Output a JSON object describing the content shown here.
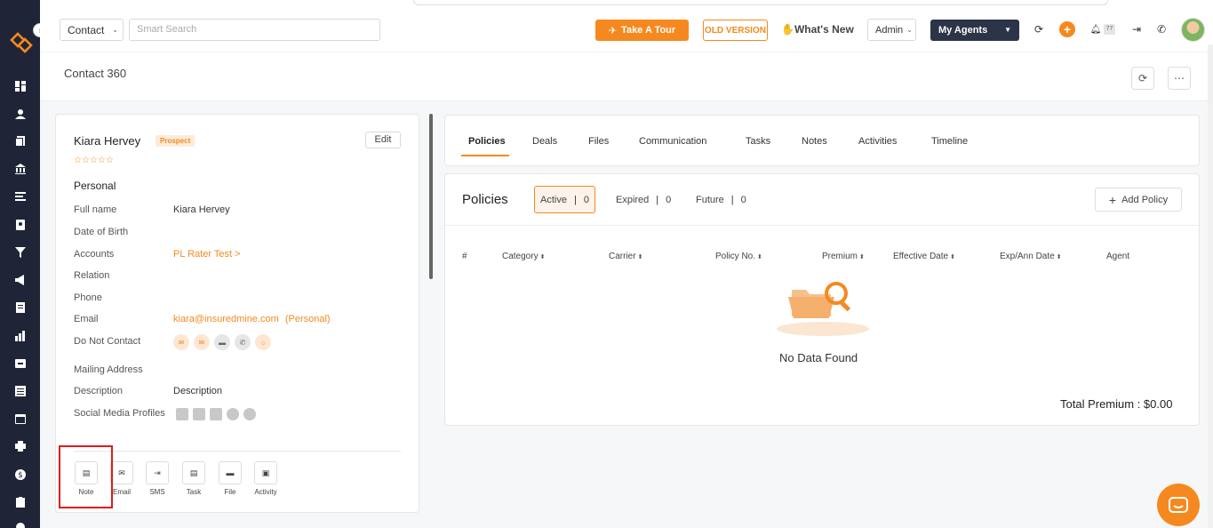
{
  "topbar": {
    "entity_select": "Contact",
    "search_placeholder": "Smart Search",
    "tour_label": "Take A Tour",
    "old_version_label": "OLD VERSION",
    "whats_new_label": "What's New",
    "role_select": "Admin",
    "agents_label": "My Agents",
    "notification_count": "77"
  },
  "page": {
    "title": "Contact 360"
  },
  "contact": {
    "name": "Kiara Hervey",
    "status": "Prospect",
    "rating": "☆☆☆☆☆",
    "edit_label": "Edit",
    "section": "Personal",
    "fields": {
      "full_name_label": "Full name",
      "full_name": "Kiara Hervey",
      "dob_label": "Date of Birth",
      "accounts_label": "Accounts",
      "accounts": "PL Rater Test >",
      "relation_label": "Relation",
      "phone_label": "Phone",
      "email_label": "Email",
      "email": "kiara@insuredmine.com",
      "email_type": "(Personal)",
      "dnc_label": "Do Not Contact",
      "mailing_label": "Mailing Address",
      "description_label": "Description",
      "description": "Description",
      "social_label": "Social Media Profiles"
    },
    "actions": [
      {
        "label": "Note"
      },
      {
        "label": "Email"
      },
      {
        "label": "SMS"
      },
      {
        "label": "Task"
      },
      {
        "label": "File"
      },
      {
        "label": "Activity"
      }
    ]
  },
  "tabs": [
    "Policies",
    "Deals",
    "Files",
    "Communication",
    "Tasks",
    "Notes",
    "Activities",
    "Timeline"
  ],
  "policies": {
    "title": "Policies",
    "filters": [
      {
        "label": "Active",
        "count": "0"
      },
      {
        "label": "Expired",
        "count": "0"
      },
      {
        "label": "Future",
        "count": "0"
      }
    ],
    "add_label": "Add Policy",
    "columns": [
      "#",
      "Category",
      "Carrier",
      "Policy No.",
      "Premium",
      "Effective Date",
      "Exp/Ann Date",
      "Agent"
    ],
    "empty_text": "No Data Found",
    "total_label": "Total Premium : $0.00"
  },
  "colors": {
    "accent": "#f5891f",
    "sidebar": "#1f2536",
    "dark_button": "#2c3447",
    "highlight": "#e01b1b"
  }
}
